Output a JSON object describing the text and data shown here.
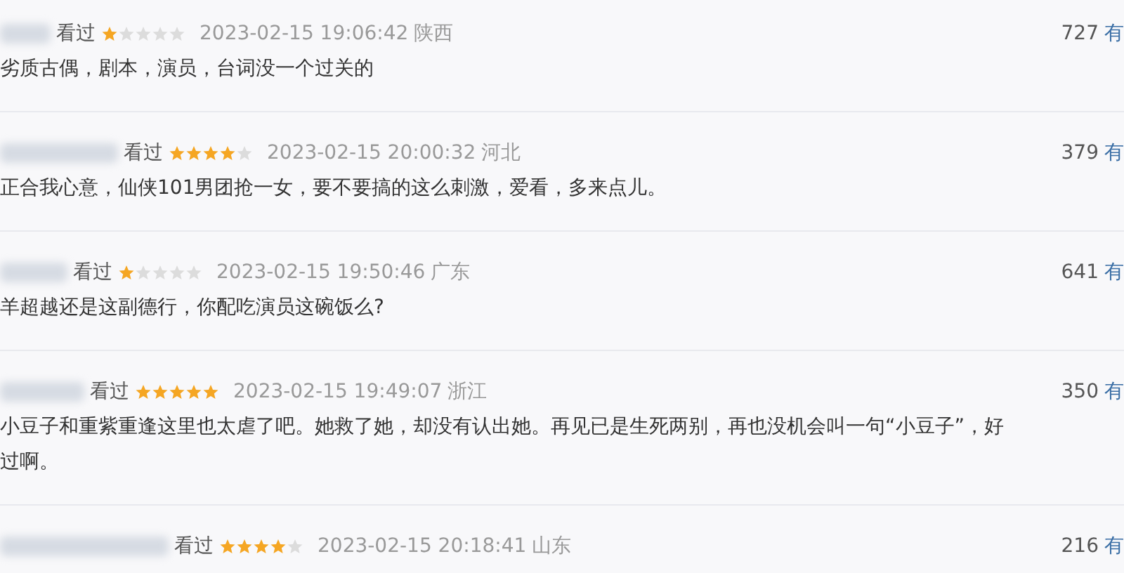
{
  "comments": [
    {
      "status": "看过",
      "stars": 1,
      "time": "2023-02-15 19:06:42",
      "location": "陕西",
      "votes": "727",
      "vote_label": "有",
      "lines": [
        "劣质古偶，剧本，演员，台词没一个过关的"
      ]
    },
    {
      "status": "看过",
      "stars": 4,
      "time": "2023-02-15 20:00:32",
      "location": "河北",
      "votes": "379",
      "vote_label": "有",
      "lines": [
        "正合我心意，仙侠101男团抢一女，要不要搞的这么刺激，爱看，多来点儿。"
      ]
    },
    {
      "status": "看过",
      "stars": 1,
      "time": "2023-02-15 19:50:46",
      "location": "广东",
      "votes": "641",
      "vote_label": "有",
      "lines": [
        "羊超越还是这副德行，你配吃演员这碗饭么?"
      ]
    },
    {
      "status": "看过",
      "stars": 5,
      "time": "2023-02-15 19:49:07",
      "location": "浙江",
      "votes": "350",
      "vote_label": "有",
      "lines": [
        "小豆子和重紫重逢这里也太虐了吧。她救了她，却没有认出她。再见已是生死两别，再也没机会叫一句“小豆子”，好",
        "过啊。"
      ]
    },
    {
      "status": "看过",
      "stars": 4,
      "time": "2023-02-15 20:18:41",
      "location": "山东",
      "votes": "216",
      "vote_label": "有"
    }
  ]
}
